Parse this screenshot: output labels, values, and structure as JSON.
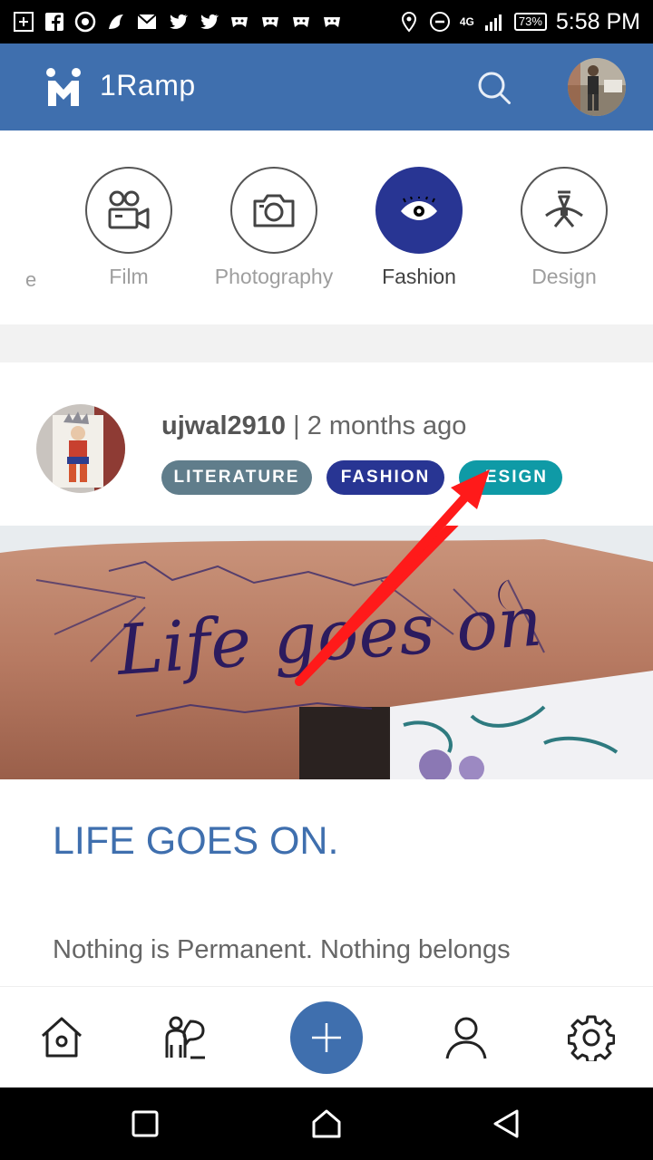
{
  "status_bar": {
    "network": "4G",
    "battery": "73%",
    "time": "5:58 PM"
  },
  "app_bar": {
    "title": "1Ramp",
    "brand_color": "#3f6fae"
  },
  "categories": {
    "items": [
      {
        "label": "Film",
        "icon": "film-icon",
        "active": false
      },
      {
        "label": "Photography",
        "icon": "camera-icon",
        "active": false
      },
      {
        "label": "Fashion",
        "icon": "eye-icon",
        "active": true
      },
      {
        "label": "Design",
        "icon": "design-pen-icon",
        "active": false
      }
    ],
    "partial_label": "e",
    "active_color": "#283593"
  },
  "post": {
    "username": "ujwal2910",
    "separator": " | ",
    "time_ago": "2 months ago",
    "tags": [
      {
        "label": "LITERATURE",
        "color": "#607d8b"
      },
      {
        "label": "FASHION",
        "color": "#283593"
      },
      {
        "label": "ESIGN",
        "color": "#0f9aa6"
      }
    ],
    "image_text": "Life goes on",
    "title": "LIFE GOES ON.",
    "excerpt": "Nothing is Permanent. Nothing belongs"
  },
  "bottom_nav": {
    "items": [
      "home-icon",
      "people-icon",
      "add-icon",
      "profile-icon",
      "settings-icon"
    ]
  },
  "system_nav": {
    "items": [
      "recents-icon",
      "home-icon",
      "back-icon"
    ]
  }
}
